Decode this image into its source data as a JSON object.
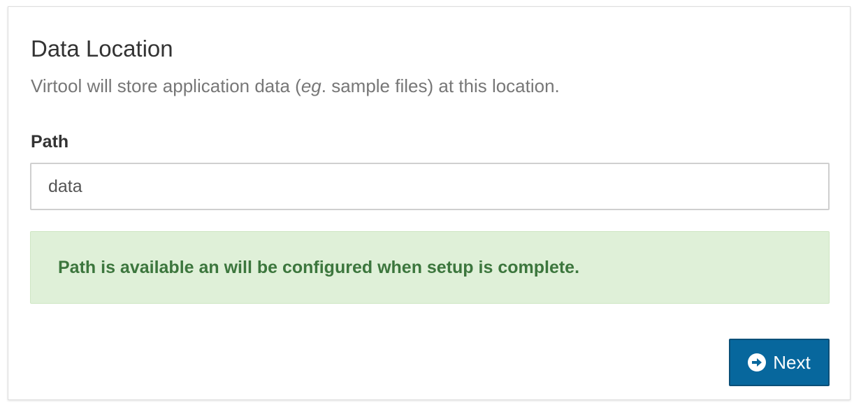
{
  "section": {
    "title": "Data Location",
    "description_before": "Virtool will store application data (",
    "description_em": "eg",
    "description_after": ". sample files) at this location."
  },
  "path_field": {
    "label": "Path",
    "value": "data",
    "placeholder": ""
  },
  "alert": {
    "message": "Path is available an will be configured when setup is complete.",
    "variant": "success",
    "color": "#3c763d",
    "background": "#dff0d8"
  },
  "next_button": {
    "label": "Next",
    "icon": "arrow-circle-right-icon",
    "color": "#07679d"
  }
}
